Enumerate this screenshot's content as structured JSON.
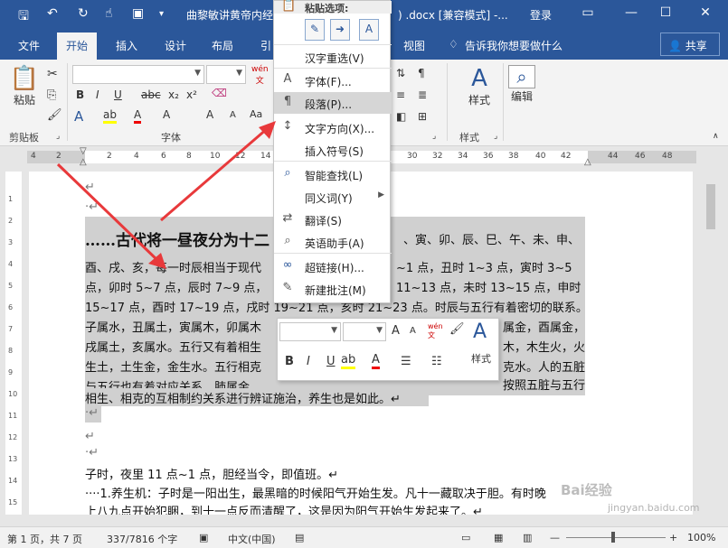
{
  "titlebar": {
    "title": "曲黎敏讲黄帝内经-",
    "title_suffix": ") .docx [兼容模式] -...",
    "login": "登录"
  },
  "tabs": [
    "文件",
    "开始",
    "插入",
    "设计",
    "布局",
    "引",
    "视图"
  ],
  "tell_me": "告诉我你想要做什么",
  "share": "共享",
  "ribbon": {
    "paste": "粘贴",
    "clipboard": "剪贴板",
    "font": "字体",
    "style_group": "样式",
    "styles": "样式",
    "edit": "编辑"
  },
  "ruler_numbers": [
    "4",
    "2",
    "2",
    "4",
    "6",
    "8",
    "10",
    "12",
    "14",
    "30",
    "32",
    "34",
    "36",
    "38",
    "40",
    "42",
    "44",
    "46",
    "48"
  ],
  "vruler_numbers": [
    "1",
    "2",
    "3",
    "4",
    "5",
    "6",
    "7",
    "8",
    "9",
    "10",
    "11",
    "12",
    "13",
    "14",
    "15"
  ],
  "doc": {
    "line_cont": "……古代将一昼夜分为十二",
    "line_cont_tail": "、寅、卯、辰、巳、午、未、申、",
    "lines": [
      "酉、戌、亥，每一时辰相当于现代",
      "点，卯时 5~7 点，辰时 7~9 点，",
      "15~17 点，酉时 17~19 点，戌时 19~21 点，亥时 21~23 点。时辰与五行有着密切的联系。",
      "子属水，丑属土，寅属木，卯属木",
      "戌属土，亥属水。五行又有着相生",
      "生土，土生金，金生水。五行相克",
      "与五行也有着对应关系，肺属金，",
      "相生、相克的互相制约关系进行辨证施治，养生也是如此。↵"
    ],
    "right_frags": [
      "~1 点，丑时 1~3 点，寅时 3~5",
      "11~13 点，未时 13~15 点，申时",
      "属金，酉属金，",
      "木，木生火，火",
      "克水。人的五脏",
      "按照五脏与五行"
    ],
    "after": [
      "子时，夜里 11 点~1 点，胆经当令，即值班。↵",
      "····1.养生机：子时是一阳出生，最黑暗的时候阳气开始生发。凡十一藏取决于胆。有时晚",
      "上八九点开始犯睏，到十一点反而清醒了，这是因为阳气开始生发起来了。↵"
    ]
  },
  "context_menu": {
    "header": "粘贴选项:",
    "items": [
      {
        "label": "汉字重选(V)",
        "icon": ""
      },
      {
        "label": "字体(F)...",
        "icon": "A"
      },
      {
        "label": "段落(P)...",
        "icon": "¶"
      },
      {
        "label": "文字方向(X)...",
        "icon": "↕"
      },
      {
        "label": "插入符号(S)",
        "icon": ""
      },
      {
        "label": "智能查找(L)",
        "icon": "⌕"
      },
      {
        "label": "同义词(Y)",
        "icon": ""
      },
      {
        "label": "翻译(S)",
        "icon": "⇄"
      },
      {
        "label": "英语助手(A)",
        "icon": "⌕"
      },
      {
        "label": "超链接(H)...",
        "icon": "∞"
      },
      {
        "label": "新建批注(M)",
        "icon": "✎"
      }
    ]
  },
  "minibar": {
    "styles": "样式"
  },
  "status": {
    "page": "第 1 页，共 7 页",
    "words": "337/7816 个字",
    "lang": "中文(中国)",
    "zoom": "100%"
  },
  "watermark": "Bai经验",
  "watermark_url": "jingyan.baidu.com"
}
